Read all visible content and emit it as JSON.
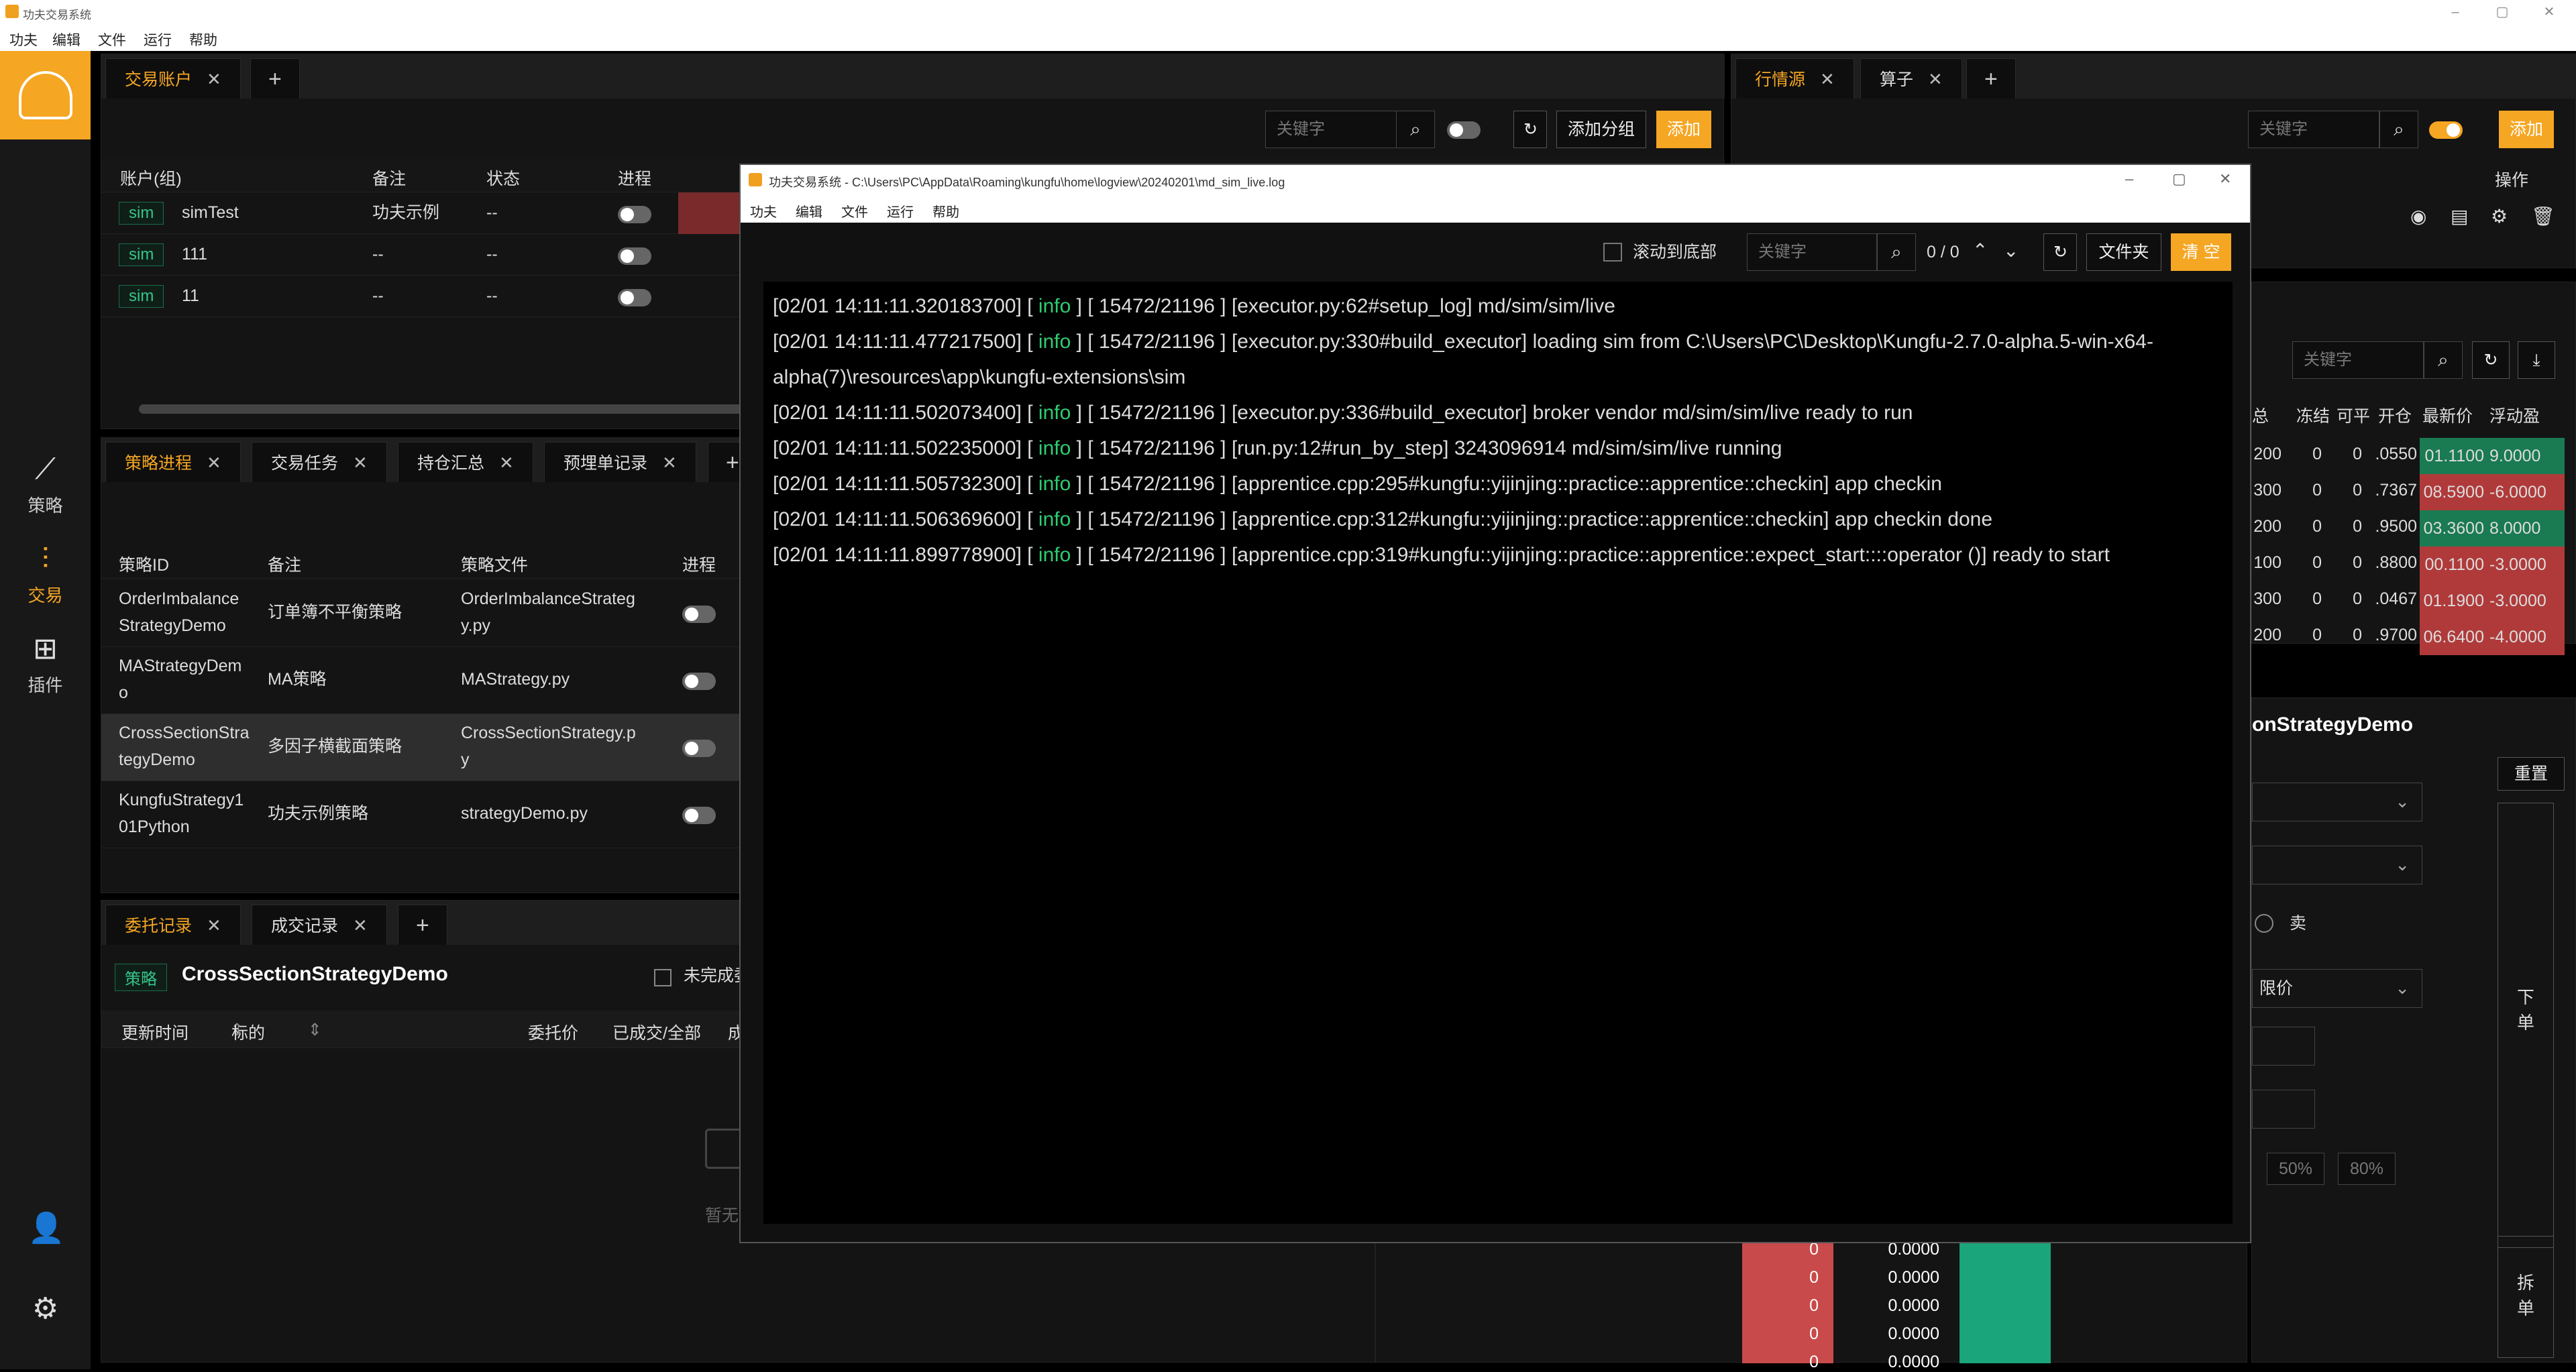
{
  "app": {
    "title": "功夫交易系统"
  },
  "menu": [
    "功夫",
    "编辑",
    "文件",
    "运行",
    "帮助"
  ],
  "nav": [
    {
      "label": "策略",
      "icon": "chart-icon"
    },
    {
      "label": "交易",
      "icon": "trade-icon"
    },
    {
      "label": "插件",
      "icon": "plugin-icon"
    }
  ],
  "account_panel": {
    "tabs": [
      "交易账户"
    ],
    "search_placeholder": "关键字",
    "add_group": "添加分组",
    "add": "添加",
    "columns": [
      "账户(组)",
      "备注",
      "状态",
      "进程"
    ],
    "rows": [
      {
        "tag": "sim",
        "name": "simTest",
        "note": "功夫示例",
        "status": "--"
      },
      {
        "tag": "sim",
        "name": "111",
        "note": "--",
        "status": "--"
      },
      {
        "tag": "sim",
        "name": "11",
        "note": "--",
        "status": "--"
      }
    ]
  },
  "strategy_panel": {
    "tabs": [
      "策略进程",
      "交易任务",
      "持仓汇总",
      "预埋单记录"
    ],
    "columns": [
      "策略ID",
      "备注",
      "策略文件",
      "进程"
    ],
    "rows": [
      {
        "id_1": "OrderImbalance",
        "id_2": "StrategyDemo",
        "note": "订单簿不平衡策略",
        "file_1": "OrderImbalanceStrateg",
        "file_2": "y.py"
      },
      {
        "id_1": "MAStrategyDem",
        "id_2": "o",
        "note": "MA策略",
        "file_1": "MAStrategy.py",
        "file_2": ""
      },
      {
        "id_1": "CrossSectionStra",
        "id_2": "tegyDemo",
        "note": "多因子横截面策略",
        "file_1": "CrossSectionStrategy.p",
        "file_2": "y"
      },
      {
        "id_1": "KungfuStrategy1",
        "id_2": "01Python",
        "note": "功夫示例策略",
        "file_1": "strategyDemo.py",
        "file_2": ""
      }
    ]
  },
  "order_panel": {
    "tabs": [
      "委托记录",
      "成交记录"
    ],
    "tag": "策略",
    "strategy": "CrossSectionStrategyDemo",
    "unfinished": "未完成委",
    "columns": [
      "更新时间",
      "标的",
      "委托价",
      "已成交/全部",
      "成"
    ],
    "empty": "暂无"
  },
  "market_panel": {
    "tabs": [
      "行情源",
      "算子"
    ],
    "search_placeholder": "关键字",
    "add": "添加",
    "ops_header": "操作"
  },
  "position_panel": {
    "search_placeholder": "关键字",
    "columns": [
      "总",
      "冻结",
      "可平",
      "开仓",
      "最新价",
      "浮动盈"
    ],
    "rows": [
      {
        "total": "200",
        "frozen": "0",
        "avail": "0",
        "open": ".0550",
        "last": "01.1100",
        "pnl": "9.0000",
        "color": "#1a7a52"
      },
      {
        "total": "300",
        "frozen": "0",
        "avail": "0",
        "open": ".7367",
        "last": "08.5900",
        "pnl": "-6.0000",
        "color": "#b03a3a"
      },
      {
        "total": "200",
        "frozen": "0",
        "avail": "0",
        "open": ".9500",
        "last": "03.3600",
        "pnl": "8.0000",
        "color": "#1a7a52"
      },
      {
        "total": "100",
        "frozen": "0",
        "avail": "0",
        "open": ".8800",
        "last": "00.1100",
        "pnl": "-3.0000",
        "color": "#b03a3a"
      },
      {
        "total": "300",
        "frozen": "0",
        "avail": "0",
        "open": ".0467",
        "last": "01.1900",
        "pnl": "-3.0000",
        "color": "#b03a3a"
      },
      {
        "total": "200",
        "frozen": "0",
        "avail": "0",
        "open": ".9700",
        "last": "06.6400",
        "pnl": "-4.0000",
        "color": "#b03a3a"
      }
    ]
  },
  "order_entry": {
    "strategy": "onStrategyDemo",
    "reset": "重置",
    "sell": "卖",
    "price_type": "限价",
    "pct": [
      "50%",
      "80%"
    ],
    "place_order": [
      "下",
      "单"
    ],
    "split_order": [
      "拆",
      "单"
    ]
  },
  "depth": {
    "left": [
      "0",
      "0",
      "0",
      "0",
      "0"
    ],
    "right": [
      "0.0000",
      "0.0000",
      "0.0000",
      "0.0000",
      "0.0000"
    ]
  },
  "log_window": {
    "title": "功夫交易系统 - C:\\Users\\PC\\AppData\\Roaming\\kungfu\\home\\logview\\20240201\\md_sim_live.log",
    "menu": [
      "功夫",
      "编辑",
      "文件",
      "运行",
      "帮助"
    ],
    "scroll_to_bottom": "滚动到底部",
    "search_placeholder": "关键字",
    "count": "0 / 0",
    "folder": "文件夹",
    "clear": "清 空",
    "lines": [
      {
        "ts": "[02/01 14:11:11.320183700]",
        "lvl": "info",
        "pid": "[ 15472/21196 ]",
        "msg": "[executor.py:62#setup_log] md/sim/sim/live"
      },
      {
        "ts": "[02/01 14:11:11.477217500]",
        "lvl": "info",
        "pid": "[ 15472/21196 ]",
        "msg": "[executor.py:330#build_executor] loading sim from C:\\Users\\PC\\Desktop\\Kungfu-2.7.0-alpha.5-win-x64-alpha(7)\\resources\\app\\kungfu-extensions\\sim"
      },
      {
        "ts": "[02/01 14:11:11.502073400]",
        "lvl": "info",
        "pid": "[ 15472/21196 ]",
        "msg": "[executor.py:336#build_executor] broker vendor md/sim/sim/live ready to run"
      },
      {
        "ts": "[02/01 14:11:11.502235000]",
        "lvl": "info",
        "pid": "[ 15472/21196 ]",
        "msg": "[run.py:12#run_by_step] 3243096914 md/sim/sim/live running"
      },
      {
        "ts": "[02/01 14:11:11.505732300]",
        "lvl": "info",
        "pid": "[ 15472/21196 ]",
        "msg": "[apprentice.cpp:295#kungfu::yijinjing::practice::apprentice::checkin] app checkin"
      },
      {
        "ts": "[02/01 14:11:11.506369600]",
        "lvl": "info",
        "pid": "[ 15472/21196 ]",
        "msg": "[apprentice.cpp:312#kungfu::yijinjing::practice::apprentice::checkin] app checkin done"
      },
      {
        "ts": "[02/01 14:11:11.899778900]",
        "lvl": "info",
        "pid": "[ 15472/21196 ]",
        "msg": "[apprentice.cpp:319#kungfu::yijinjing::practice::apprentice::expect_start::::operator ()] ready to start"
      }
    ]
  }
}
